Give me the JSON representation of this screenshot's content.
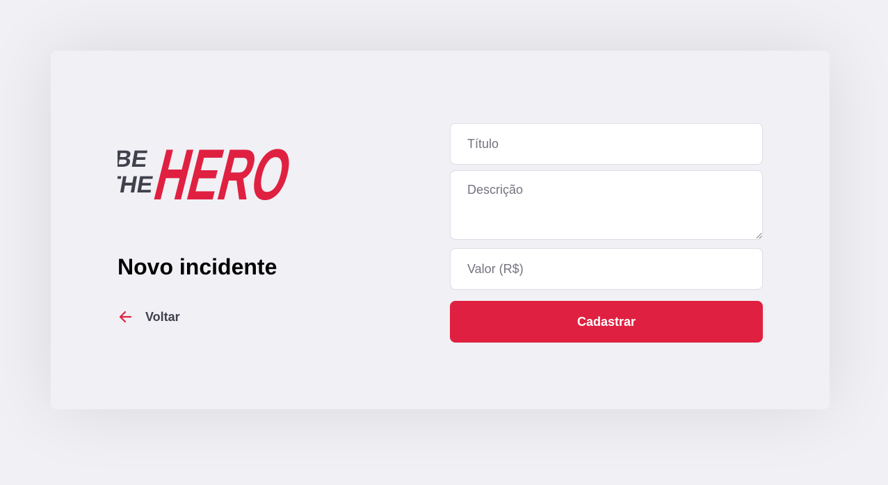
{
  "logo": {
    "line1": "BE",
    "line2": "THE",
    "main": "HERO",
    "colors": {
      "small": "#41414d",
      "main": "#e02041"
    }
  },
  "page": {
    "title": "Novo incidente",
    "back_label": "Voltar",
    "back_icon": "arrow-left-icon"
  },
  "form": {
    "title_placeholder": "Título",
    "description_placeholder": "Descrição",
    "value_placeholder": "Valor (R$)",
    "submit_label": "Cadastrar"
  },
  "colors": {
    "background": "#f0f0f5",
    "accent": "#e02041",
    "text_dark": "#41414d",
    "placeholder": "#737380"
  }
}
